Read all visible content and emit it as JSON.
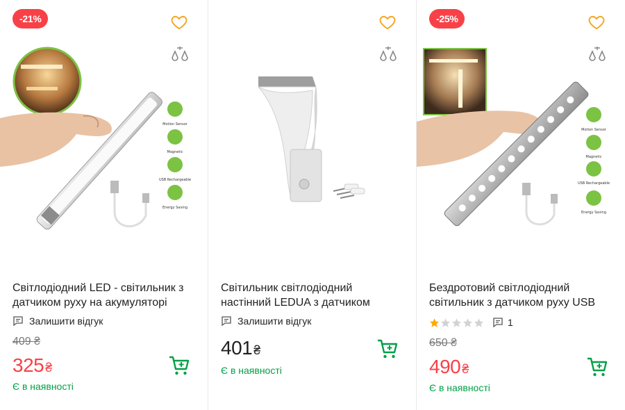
{
  "colors": {
    "discount": "#f84147",
    "stock": "#00a046",
    "wish": "#f5a623",
    "cart": "#00a046"
  },
  "products": [
    {
      "badge": "-21%",
      "title": "Світлодіодний LED - світильник з датчиком руху на акумуляторі",
      "review_label": "Залишити відгук",
      "old_price": "409",
      "price": "325",
      "currency": "₴",
      "stock": "Є в наявності",
      "image_labels": [
        "Motion Sensor",
        "Magnetic",
        "USB Rechargeable",
        "Energy Saving"
      ]
    },
    {
      "title": "Світильник світлодіодний настінний LEDUA з датчиком",
      "review_label": "Залишити відгук",
      "price": "401",
      "currency": "₴",
      "stock": "Є в наявності"
    },
    {
      "badge": "-25%",
      "title": "Бездротовий світлодіодний світильник з датчиком руху USB",
      "rating": 1,
      "review_count": "1",
      "old_price": "650",
      "price": "490",
      "currency": "₴",
      "stock": "Є в наявності",
      "image_labels": [
        "Motion Sensor",
        "Magnetic",
        "USB Rechargeable",
        "Energy Saving"
      ]
    }
  ]
}
